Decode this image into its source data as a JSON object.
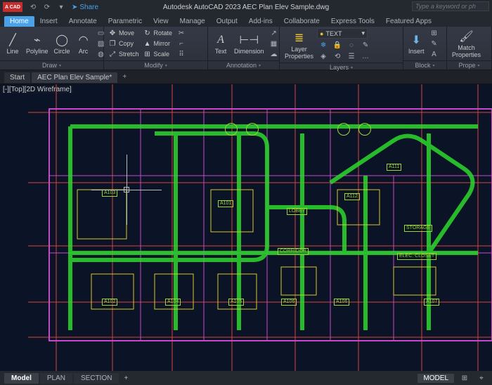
{
  "app": {
    "logo": "A CAD",
    "title": "Autodesk AutoCAD 2023   AEC Plan Elev Sample.dwg",
    "share": "Share",
    "search_placeholder": "Type a keyword or ph"
  },
  "qat": [
    "⟲",
    "⟳",
    "▾"
  ],
  "ribbon_tabs": [
    "Home",
    "Insert",
    "Annotate",
    "Parametric",
    "View",
    "Manage",
    "Output",
    "Add-ins",
    "Collaborate",
    "Express Tools",
    "Featured Apps"
  ],
  "ribbon_active": 0,
  "draw": {
    "line": "Line",
    "polyline": "Polyline",
    "circle": "Circle",
    "arc": "Arc",
    "title": "Draw"
  },
  "modify": {
    "move": "Move",
    "copy": "Copy",
    "stretch": "Stretch",
    "rotate": "Rotate",
    "mirror": "Mirror",
    "scale": "Scale",
    "title": "Modify"
  },
  "annotation": {
    "text": "Text",
    "dimension": "Dimension",
    "title": "Annotation"
  },
  "layers": {
    "layer": "Layer",
    "properties": "Properties",
    "current": "TEXT",
    "title": "Layers"
  },
  "block": {
    "insert": "Insert",
    "title": "Block"
  },
  "props": {
    "match": "Match",
    "properties": "Properties",
    "title": "Prope"
  },
  "file_tabs": {
    "start": "Start",
    "active": "AEC Plan Elev Sample*",
    "plus": "+"
  },
  "viewport_label": "[-][Top][2D Wireframe]",
  "rooms": {
    "a101": "A101",
    "a102": "A102",
    "a103": "A103",
    "a104": "A104",
    "a105": "A105",
    "a106": "A106",
    "a107": "A107",
    "a111": "A111",
    "a112": "A112",
    "lobby": "LOBBY",
    "corridor": "CORRIDOR",
    "storage": "STORAGE",
    "elec": "ELEC. CLOSET"
  },
  "layout_tabs": [
    "Model",
    "PLAN",
    "SECTION"
  ],
  "layout_active": 0,
  "status": {
    "model": "MODEL"
  },
  "layout_plus": "+"
}
